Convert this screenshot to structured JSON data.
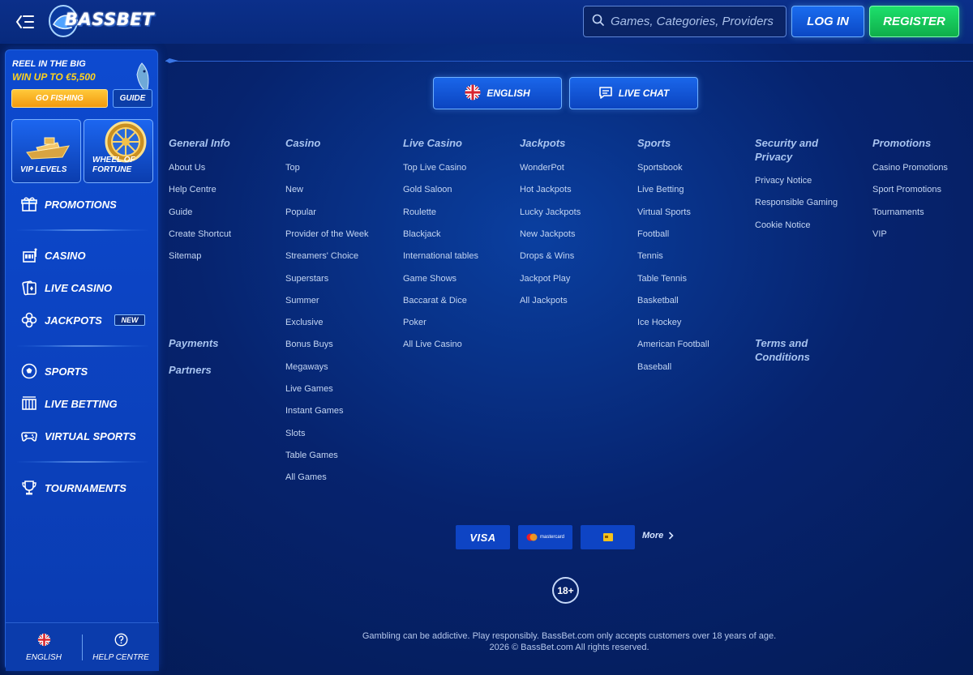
{
  "header": {
    "logo_text": "BASSBET",
    "search_placeholder": "Games, Categories, Providers",
    "login_label": "LOG IN",
    "register_label": "REGISTER"
  },
  "sidebar": {
    "promo": {
      "line1": "REEL IN THE BIG",
      "line2": "WIN UP TO €5,500",
      "go_fishing_label": "GO FISHING",
      "guide_label": "GUIDE"
    },
    "tiles": [
      {
        "label_line1": "VIP LEVELS",
        "label_line2": ""
      },
      {
        "label_line1": "WHEEL OF",
        "label_line2": "FORTUNE"
      }
    ],
    "items": [
      {
        "label": "PROMOTIONS",
        "icon": "gift-icon"
      },
      {
        "label": "CASINO",
        "icon": "casino-icon"
      },
      {
        "label": "LIVE CASINO",
        "icon": "cards-icon"
      },
      {
        "label": "JACKPOTS",
        "icon": "clover-icon",
        "badge": "NEW"
      },
      {
        "label": "SPORTS",
        "icon": "soccer-ball-icon"
      },
      {
        "label": "LIVE BETTING",
        "icon": "stadium-icon"
      },
      {
        "label": "VIRTUAL SPORTS",
        "icon": "gamepad-icon"
      },
      {
        "label": "TOURNAMENTS",
        "icon": "trophy-icon"
      }
    ],
    "footer": {
      "language_label": "ENGLISH",
      "help_label": "HELP CENTRE"
    }
  },
  "main": {
    "language_button": "ENGLISH",
    "live_chat_button": "LIVE CHAT",
    "columns": [
      {
        "title": "General Info",
        "links": [
          "About Us",
          "Help Centre",
          "Guide",
          "Create Shortcut",
          "Sitemap"
        ]
      },
      {
        "title": "Casino",
        "links": [
          "Top",
          "New",
          "Popular",
          "Provider of the Week",
          "Streamers' Choice",
          "Superstars",
          "Summer",
          "Exclusive",
          "Bonus Buys",
          "Megaways",
          "Live Games",
          "Instant Games",
          "Slots",
          "Table Games",
          "All Games"
        ]
      },
      {
        "title": "Live Casino",
        "links": [
          "Top Live Casino",
          "Gold Saloon",
          "Roulette",
          "Blackjack",
          "International tables",
          "Game Shows",
          "Baccarat & Dice",
          "Poker",
          "All Live Casino"
        ]
      },
      {
        "title": "Jackpots",
        "links": [
          "WonderPot",
          "Hot Jackpots",
          "Lucky Jackpots",
          "New Jackpots",
          "Drops & Wins",
          "Jackpot Play",
          "All Jackpots"
        ]
      },
      {
        "title": "Sports",
        "links": [
          "Sportsbook",
          "Live Betting",
          "Virtual Sports",
          "Football",
          "Tennis",
          "Table Tennis",
          "Basketball",
          "Ice Hockey",
          "American Football",
          "Baseball"
        ]
      },
      {
        "title_line1": "Security and",
        "title_line2": "Privacy",
        "links": [
          "Privacy Notice",
          "Responsible Gaming",
          "Cookie Notice"
        ]
      },
      {
        "title": "Promotions",
        "links": [
          "Casino Promotions",
          "Sport Promotions",
          "Tournaments",
          "VIP"
        ]
      }
    ],
    "payments_title": "Payments",
    "partners_title": "Partners",
    "terms_line1": "Terms and",
    "terms_line2": "Conditions",
    "payment_methods": [
      "VISA",
      "mastercard",
      "card"
    ],
    "more_label": "More",
    "age_badge": "18+",
    "disclaimer_line1": "Gambling can be addictive. Play responsibly. BassBet.com only accepts customers over 18 years of age.",
    "disclaimer_line2": "2026 © BassBet.com All rights reserved."
  },
  "colors": {
    "background": "#06236e",
    "accent_blue": "#1a66ea",
    "register_green": "#1de06c",
    "promo_yellow": "#ffd21e",
    "link_text": "#c4d6f3",
    "heading_text": "#a8c4f0"
  }
}
